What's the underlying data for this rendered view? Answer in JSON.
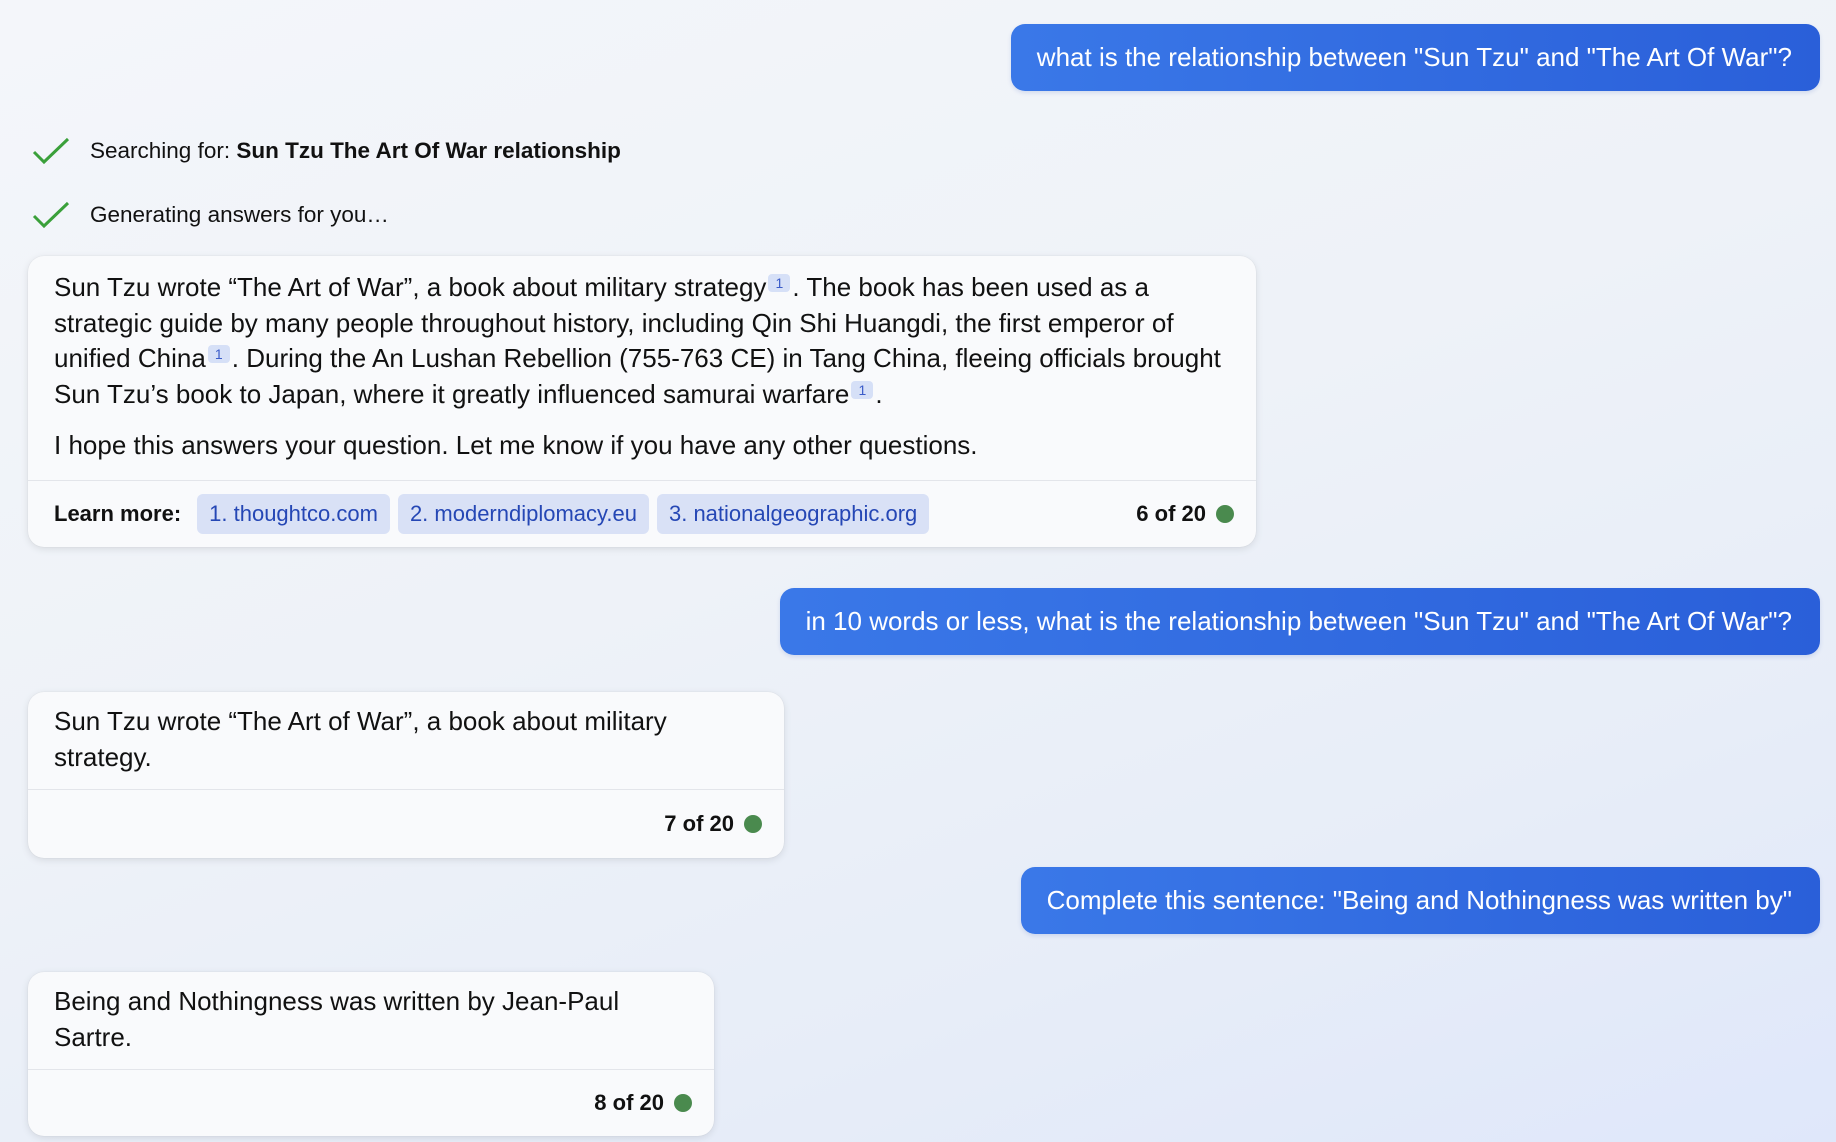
{
  "colors": {
    "accent": "#2a5fd9",
    "status_dot": "#4a8a4e",
    "check": "#3aa03a"
  },
  "messages": [
    {
      "role": "user",
      "text": "what is the relationship between \"Sun Tzu\" and \"The Art Of War\"?"
    },
    {
      "role": "user",
      "text": "in 10 words or less, what is the relationship between \"Sun Tzu\" and \"The Art Of War\"?"
    },
    {
      "role": "user",
      "text": "Complete this sentence: \"Being and Nothingness was written by\""
    }
  ],
  "status": {
    "searching_prefix": "Searching for: ",
    "searching_query": "Sun Tzu The Art Of War relationship",
    "generating": "Generating answers for you…",
    "icon": "check-icon"
  },
  "answer1": {
    "s1": "Sun Tzu wrote “The Art of War”, a book about military strategy",
    "c1": "1",
    "s2": ". The book has been used as a strategic guide by many people throughout history, including Qin Shi Huangdi, the first emperor of unified China",
    "c2": "1",
    "s3": ". During the An Lushan Rebellion (755-763 CE) in Tang China, fleeing officials brought Sun Tzu’s book to Japan, where it greatly influenced samurai warfare",
    "c3": "1",
    "s4": ".",
    "closing": "I hope this answers your question. Let me know if you have any other questions.",
    "learn_more_label": "Learn more:",
    "sources": [
      "1. thoughtco.com",
      "2. moderndiplomacy.eu",
      "3. nationalgeographic.org"
    ],
    "counter": "6 of 20"
  },
  "answer2": {
    "text": "Sun Tzu wrote “The Art of War”, a book about military strategy.",
    "counter": "7 of 20"
  },
  "answer3": {
    "text": "Being and Nothingness was written by Jean-Paul Sartre.",
    "counter": "8 of 20"
  }
}
